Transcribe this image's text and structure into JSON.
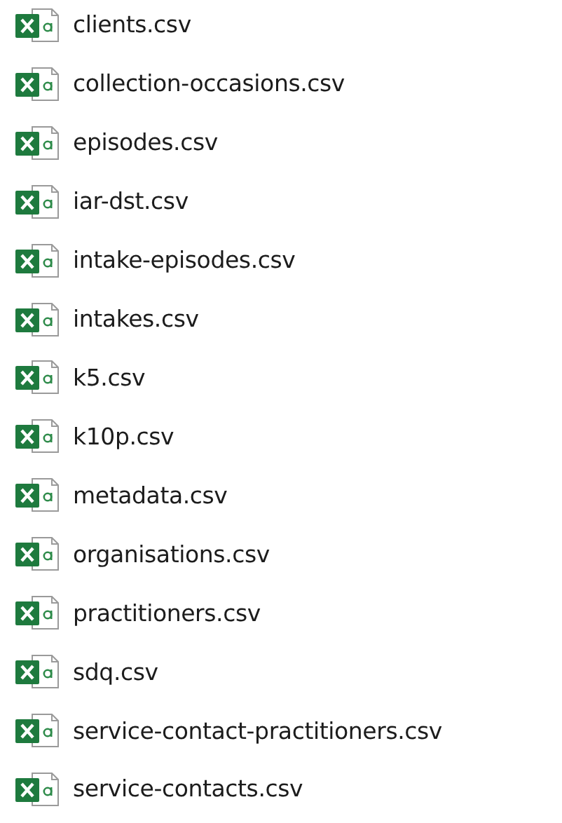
{
  "files": [
    {
      "name": "clients.csv"
    },
    {
      "name": "collection-occasions.csv"
    },
    {
      "name": "episodes.csv"
    },
    {
      "name": "iar-dst.csv"
    },
    {
      "name": "intake-episodes.csv"
    },
    {
      "name": "intakes.csv"
    },
    {
      "name": "k5.csv"
    },
    {
      "name": "k10p.csv"
    },
    {
      "name": "metadata.csv"
    },
    {
      "name": "organisations.csv"
    },
    {
      "name": "practitioners.csv"
    },
    {
      "name": "sdq.csv"
    },
    {
      "name": "service-contact-practitioners.csv"
    },
    {
      "name": "service-contacts.csv"
    }
  ]
}
